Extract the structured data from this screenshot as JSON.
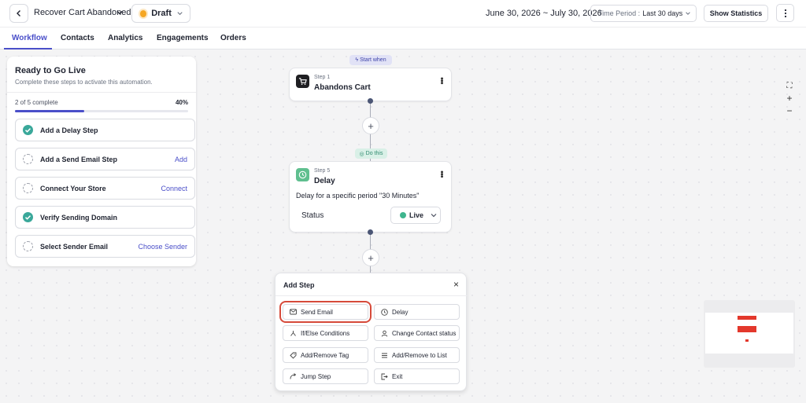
{
  "header": {
    "workflow_title": "Recover Cart Abandoned",
    "status_label": "Draft",
    "date_range": "June 30, 2026 ~ July 30, 2026",
    "time_period_prefix": "Time Period :",
    "time_period_value": "Last 30 days",
    "show_statistics_label": "Show Statistics"
  },
  "tabs": [
    {
      "label": "Workflow",
      "active": true
    },
    {
      "label": "Contacts",
      "active": false
    },
    {
      "label": "Analytics",
      "active": false
    },
    {
      "label": "Engagements",
      "active": false
    },
    {
      "label": "Orders",
      "active": false
    }
  ],
  "checklist": {
    "title": "Ready to Go Live",
    "subtitle": "Complete these steps to activate this automation.",
    "progress_label": "2 of 5 complete",
    "progress_percent": "40%",
    "progress_value": 0.4,
    "items": [
      {
        "label": "Add a Delay Step",
        "done": true,
        "action": ""
      },
      {
        "label": "Add a Send Email Step",
        "done": false,
        "action": "Add"
      },
      {
        "label": "Connect Your Store",
        "done": false,
        "action": "Connect"
      },
      {
        "label": "Verify Sending Domain",
        "done": true,
        "action": ""
      },
      {
        "label": "Select Sender Email",
        "done": false,
        "action": "Choose Sender"
      }
    ]
  },
  "flow": {
    "start_pill": "Start when",
    "do_pill": "Do this",
    "step1": {
      "number": "Step 1",
      "title": "Abandons Cart"
    },
    "step5": {
      "number": "Step 5",
      "title": "Delay",
      "description": "Delay for a specific period \"30 Minutes\"",
      "status_label": "Status",
      "status_value": "Live"
    },
    "plus_label": "+"
  },
  "add_step": {
    "title": "Add Step",
    "close_label": "×",
    "options": [
      {
        "label": "Send Email",
        "icon": "mail-icon",
        "selected": true
      },
      {
        "label": "Delay",
        "icon": "clock-icon",
        "selected": false
      },
      {
        "label": "If/Else Conditions",
        "icon": "branch-icon",
        "selected": false
      },
      {
        "label": "Change Contact status",
        "icon": "user-icon",
        "selected": false
      },
      {
        "label": "Add/Remove Tag",
        "icon": "tag-icon",
        "selected": false
      },
      {
        "label": "Add/Remove to List",
        "icon": "list-icon",
        "selected": false
      },
      {
        "label": "Jump Step",
        "icon": "jump-icon",
        "selected": false
      },
      {
        "label": "Exit",
        "icon": "exit-icon",
        "selected": false
      }
    ]
  },
  "zoom": {
    "fit_label": "⛶",
    "in_label": "+",
    "out_label": "−"
  },
  "colors": {
    "accent": "#4a4fc9",
    "success": "#3aa89a",
    "draft": "#f5a623",
    "highlight": "#d64a3a",
    "minimap_node": "#e3382c"
  }
}
